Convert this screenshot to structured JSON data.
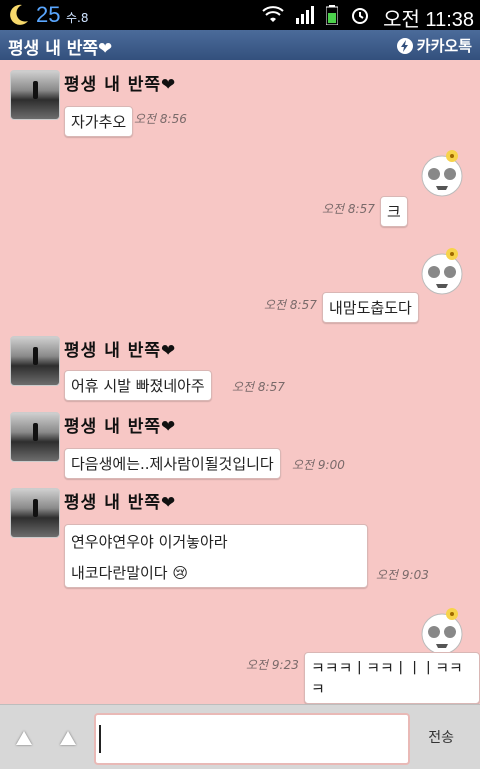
{
  "status_bar": {
    "temperature": "25",
    "day": "수.8",
    "time": "오전 11:38"
  },
  "titlebar": {
    "title": "평생 내 반쪽❤",
    "brand": "카카오톡"
  },
  "messages": [
    {
      "name": "평생 내 반쪽❤",
      "text": "자가추오",
      "time": "오전 8:56"
    },
    {
      "text": "크",
      "time": "오전 8:57"
    },
    {
      "text": "내맘도춥도다",
      "time": "오전 8:57"
    },
    {
      "name": "평생 내 반쪽❤",
      "text": "어휴 시발 빠졌네아주",
      "time": "오전 8:57"
    },
    {
      "name": "평생 내 반쪽❤",
      "text": "다음생에는..제사람이될것입니다",
      "time": "오전 9:00"
    },
    {
      "name": "평생 내 반쪽❤",
      "line1": "연우야연우야 이거놓아라",
      "line2": "내코다란말이다 😢",
      "time": "오전 9:03"
    },
    {
      "text": "ㅋㅋㅋㅣㅋㅋㅣㅣㅣㅋㅋㅋ",
      "time": "오전 9:23"
    }
  ],
  "bottom_bar": {
    "send_label": "전송",
    "input_value": ""
  }
}
